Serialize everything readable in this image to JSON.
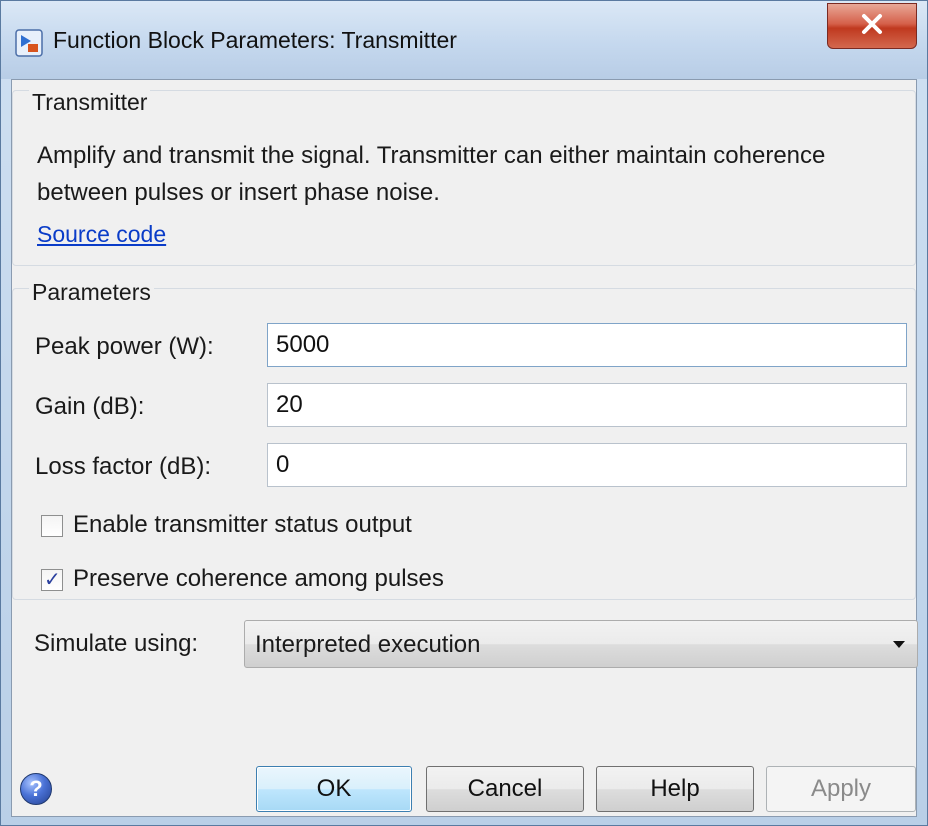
{
  "window": {
    "title": "Function Block Parameters: Transmitter",
    "close_glyph": "X"
  },
  "description_group": {
    "title": "Transmitter",
    "text": "Amplify and transmit the signal. Transmitter can either maintain coherence between pulses or insert phase noise.",
    "link_label": "Source code"
  },
  "parameters_group": {
    "title": "Parameters",
    "fields": [
      {
        "label": "Peak power (W):",
        "value": "5000"
      },
      {
        "label": "Gain (dB):",
        "value": "20"
      },
      {
        "label": "Loss factor (dB):",
        "value": "0"
      }
    ],
    "checkboxes": [
      {
        "label": "Enable transmitter status output",
        "checked": false
      },
      {
        "label": "Preserve coherence among pulses",
        "checked": true
      }
    ]
  },
  "simulate": {
    "label": "Simulate using:",
    "selected": "Interpreted execution"
  },
  "buttons": {
    "help_icon": "?",
    "ok": "OK",
    "cancel": "Cancel",
    "help": "Help",
    "apply": "Apply"
  },
  "icons": {
    "app": "simulink-block-icon",
    "close": "close-icon",
    "help": "help-icon",
    "check": "checkmark-icon",
    "dropdown": "chevron-down-icon"
  },
  "colors": {
    "link": "#0a3cc8",
    "close_button": "#c0391f",
    "default_button_border": "#3c7fb1",
    "check": "#2a3f9e"
  }
}
